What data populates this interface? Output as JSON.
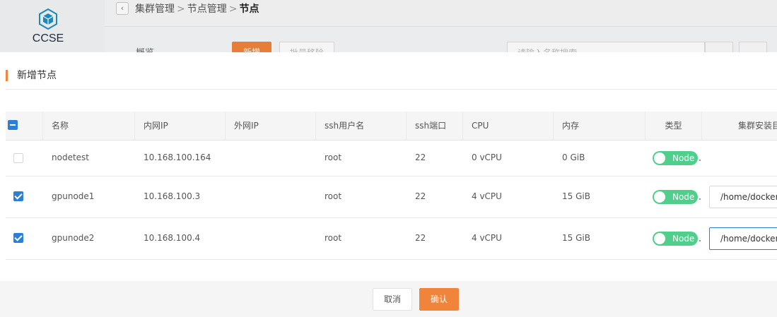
{
  "app": {
    "logo_text": "CCSE"
  },
  "breadcrumb": {
    "items": [
      "集群管理",
      "节点管理"
    ],
    "current": "节点",
    "separator": ">"
  },
  "toolbar": {
    "label": "概览",
    "add_label": "新增",
    "batch_label": "批量移除",
    "search_placeholder": "请输入名称搜索"
  },
  "dialog": {
    "title": "新增节点",
    "columns": [
      "名称",
      "内网IP",
      "外网IP",
      "ssh用户名",
      "ssh端口",
      "CPU",
      "内存",
      "类型",
      "集群安装目录"
    ],
    "rows": [
      {
        "checked": false,
        "name": "nodetest",
        "internal_ip": "10.168.100.164",
        "external_ip": "",
        "ssh_user": "root",
        "ssh_port": "22",
        "cpu": "0 vCPU",
        "memory": "0 GiB",
        "type": "Node",
        "install_dir": ""
      },
      {
        "checked": true,
        "name": "gpunode1",
        "internal_ip": "10.168.100.3",
        "external_ip": "",
        "ssh_user": "root",
        "ssh_port": "22",
        "cpu": "4 vCPU",
        "memory": "15 GiB",
        "type": "Node",
        "install_dir": "/home/docker"
      },
      {
        "checked": true,
        "name": "gpunode2",
        "internal_ip": "10.168.100.4",
        "external_ip": "",
        "ssh_user": "root",
        "ssh_port": "22",
        "cpu": "4 vCPU",
        "memory": "15 GiB",
        "type": "Node",
        "install_dir": "/home/docker"
      }
    ],
    "cancel_label": "取消",
    "confirm_label": "确认"
  },
  "colors": {
    "accent": "#f0843a",
    "checkbox": "#2b7fd6",
    "toggle": "#4fce8c"
  },
  "icons": {
    "logo": "hexagon-cube-icon",
    "back": "chevron-left-icon",
    "search": "search-icon",
    "refresh": "refresh-icon"
  }
}
